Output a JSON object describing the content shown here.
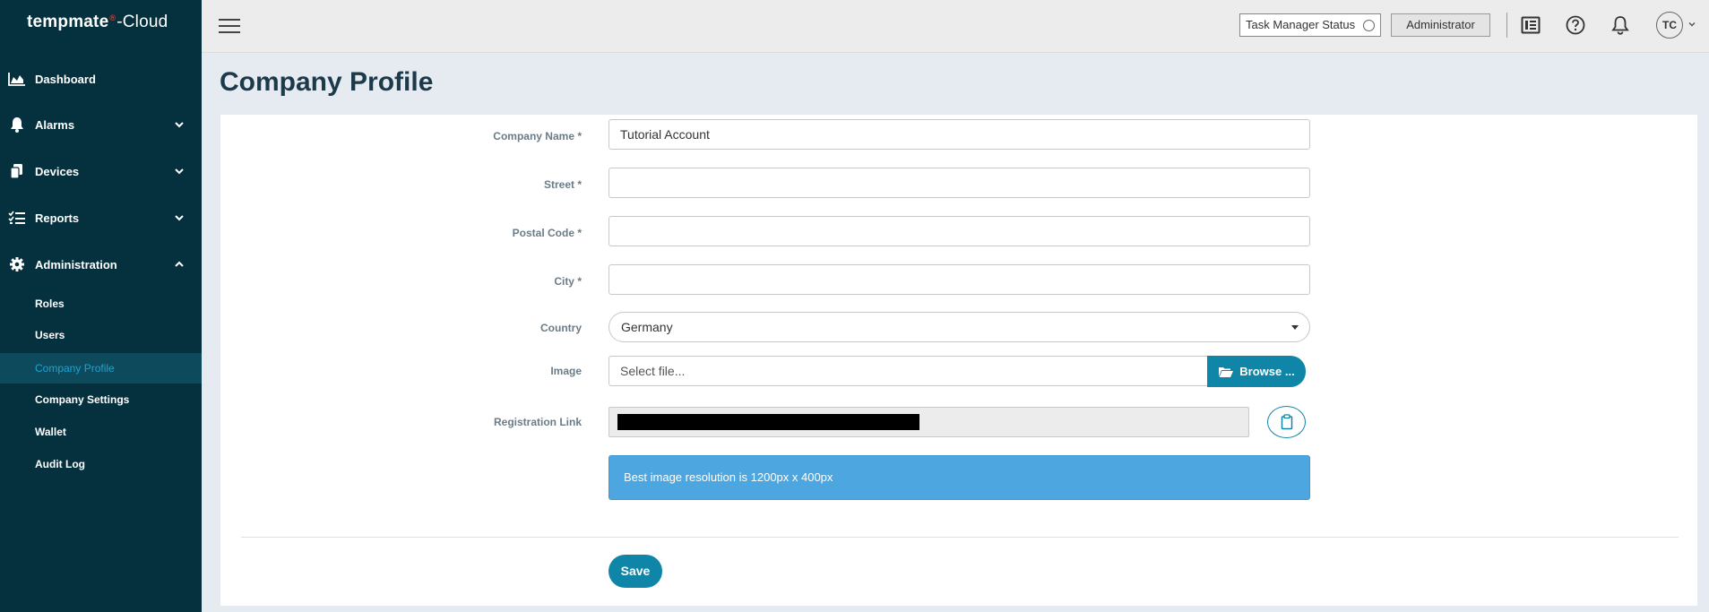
{
  "brand": {
    "name": "tempmate",
    "mark": "®",
    "suffix": "-Cloud"
  },
  "sidebar": {
    "items": [
      {
        "label": "Dashboard",
        "icon": "chart-area-icon"
      },
      {
        "label": "Alarms",
        "icon": "bell-icon",
        "expandable": true
      },
      {
        "label": "Devices",
        "icon": "devices-icon",
        "expandable": true
      },
      {
        "label": "Reports",
        "icon": "list-check-icon",
        "expandable": true
      },
      {
        "label": "Administration",
        "icon": "gear-icon",
        "expanded": true
      }
    ],
    "subitems": [
      {
        "label": "Roles"
      },
      {
        "label": "Users"
      },
      {
        "label": "Company Profile",
        "active": true
      },
      {
        "label": "Company Settings"
      },
      {
        "label": "Wallet"
      },
      {
        "label": "Audit Log"
      }
    ]
  },
  "topbar": {
    "task_status_label": "Task Manager Status",
    "role_label": "Administrator",
    "avatar_initials": "TC",
    "icons": [
      "release-notes-icon",
      "help-icon",
      "notification-bell-icon"
    ]
  },
  "page": {
    "title": "Company Profile"
  },
  "form": {
    "company_name": {
      "label": "Company Name *",
      "value": "Tutorial Account"
    },
    "street": {
      "label": "Street *",
      "value": ""
    },
    "postal_code": {
      "label": "Postal Code *",
      "value": ""
    },
    "city": {
      "label": "City *",
      "value": ""
    },
    "country": {
      "label": "Country",
      "value": "Germany"
    },
    "image": {
      "label": "Image",
      "placeholder": "Select file...",
      "browse_label": "Browse ..."
    },
    "registration_link": {
      "label": "Registration Link"
    },
    "info": "Best image resolution is 1200px x 400px",
    "save_label": "Save"
  },
  "colors": {
    "sidebar": "#05313f",
    "accent": "#0f86a8",
    "info": "#4da6e0",
    "active_text": "#1fa3d4"
  }
}
